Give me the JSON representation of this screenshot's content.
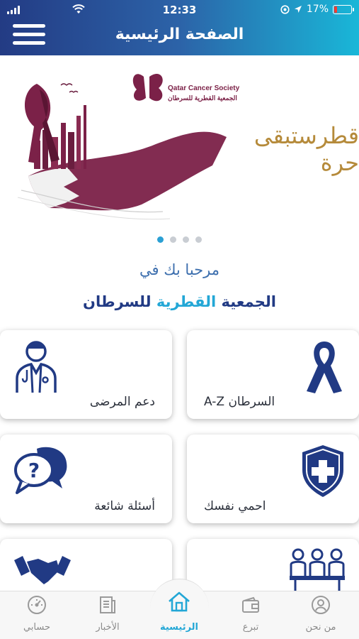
{
  "status_bar": {
    "time": "12:33",
    "battery": "17%"
  },
  "header": {
    "title": "الصفحة الرئيسية"
  },
  "banner": {
    "org_en": "Qatar Cancer Society",
    "org_ar": "الجمعية القطرية للسرطان",
    "slogan": "قطرستبقى حرة"
  },
  "carousel": {
    "count": 4,
    "active": 0
  },
  "welcome": {
    "line1": "مرحبا بك في",
    "society_part1": "الجمعية",
    "society_part2": "القطرية",
    "society_part3": "للسرطان"
  },
  "cards": {
    "cancer_az": "السرطان A-Z",
    "patient_support": "دعم المرضى",
    "protect_yourself": "احمي نفسك",
    "faq": "أسئلة شائعة"
  },
  "tabs": {
    "about": "من نحن",
    "donate": "تبرع",
    "home": "الرئيسية",
    "news": "الأخبار",
    "account": "حسابي"
  },
  "colors": {
    "header_start": "#233b84",
    "header_end": "#19b7d8",
    "accent": "#23a7d6",
    "navy": "#213a84",
    "maroon": "#7a1f45"
  }
}
